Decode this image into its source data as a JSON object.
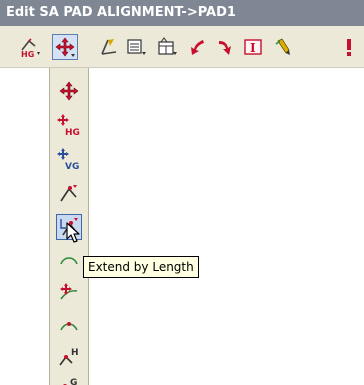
{
  "window": {
    "title": "Edit SA PAD ALIGNMENT->PAD1"
  },
  "toolbar": {
    "buttons": [
      {
        "name": "hg-pad-icon"
      },
      {
        "name": "move-icon",
        "pressed": true
      },
      {
        "name": "edit-line-icon"
      },
      {
        "name": "list-dropdown-icon"
      },
      {
        "name": "table-icon"
      },
      {
        "name": "red-arrow-left-icon"
      },
      {
        "name": "red-arrow-down-icon"
      },
      {
        "name": "text-box-icon"
      },
      {
        "name": "pen-icon"
      },
      {
        "name": "exclamation-icon"
      }
    ]
  },
  "flyout": {
    "items": [
      {
        "name": "move-icon",
        "label": ""
      },
      {
        "name": "move-hg-icon",
        "label": "HG"
      },
      {
        "name": "move-vg-icon",
        "label": "VG"
      },
      {
        "name": "extend-icon",
        "label": ""
      },
      {
        "name": "extend-by-length-icon",
        "label": "",
        "active": true
      },
      {
        "name": "arc-icon",
        "label": ""
      },
      {
        "name": "arc-move-icon",
        "label": ""
      },
      {
        "name": "curve-icon",
        "label": ""
      },
      {
        "name": "h-point-icon",
        "label": "H"
      },
      {
        "name": "g-point-icon",
        "label": "G"
      }
    ]
  },
  "tooltip": {
    "text": "Extend by Length"
  },
  "colors": {
    "title_bar": "#7f8794",
    "toolbar_bg": "#ece9d8",
    "tooltip_bg": "#ffffe1",
    "accent_red": "#c8102e",
    "accent_green": "#2e8b3a"
  }
}
